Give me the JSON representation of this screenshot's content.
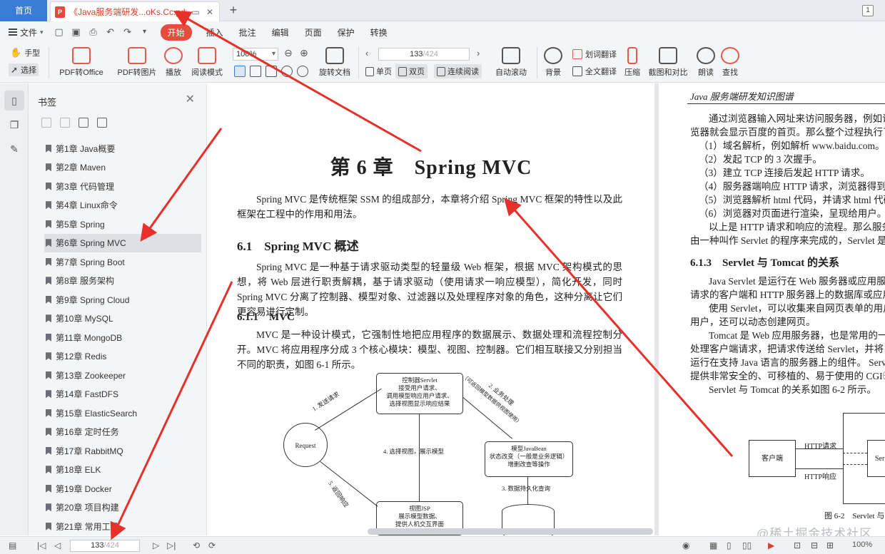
{
  "tabs": {
    "home": "首页",
    "doc_title": "《Java服务端研发...oKs.Cc.pdf",
    "count": "1"
  },
  "menu": {
    "file": "文件",
    "start": "开始",
    "items": [
      "插入",
      "批注",
      "编辑",
      "页面",
      "保护",
      "转换"
    ]
  },
  "ribbon": {
    "hand": "手型",
    "select": "选择",
    "pdf_to_office": "PDF转Office",
    "pdf_to_image": "PDF转图片",
    "play": "播放",
    "read_mode": "阅读模式",
    "zoom": "100%",
    "rotate": "旋转文档",
    "page_current": "133",
    "page_total": "/424",
    "single": "单页",
    "double": "双页",
    "continuous": "连续阅读",
    "auto_scroll": "自动滚动",
    "background": "背景",
    "word_translate": "划词翻译",
    "full_translate": "全文翻译",
    "compress": "压缩",
    "screenshot": "截图和对比",
    "read_aloud": "朗读",
    "find": "查找"
  },
  "sidebar": {
    "title": "书签",
    "items": [
      {
        "label": "第1章 Java概要"
      },
      {
        "label": "第2章 Maven"
      },
      {
        "label": "第3章 代码管理"
      },
      {
        "label": "第4章 Linux命令"
      },
      {
        "label": "第5章 Spring"
      },
      {
        "label": "第6章 Spring MVC"
      },
      {
        "label": "第7章 Spring Boot"
      },
      {
        "label": "第8章 服务架构"
      },
      {
        "label": "第9章 Spring Cloud"
      },
      {
        "label": "第10章 MySQL"
      },
      {
        "label": "第11章 MongoDB"
      },
      {
        "label": "第12章 Redis"
      },
      {
        "label": "第13章 Zookeeper"
      },
      {
        "label": "第14章 FastDFS"
      },
      {
        "label": "第15章 ElasticSearch"
      },
      {
        "label": "第16章 定时任务"
      },
      {
        "label": "第17章 RabbitMQ"
      },
      {
        "label": "第18章 ELK"
      },
      {
        "label": "第19章 Docker"
      },
      {
        "label": "第20章 项目构建"
      },
      {
        "label": "第21章 常用工具"
      }
    ]
  },
  "page1": {
    "chapter_title": "第 6 章　Spring MVC",
    "intro": "Spring MVC 是传统框架 SSM 的组成部分，本章将介绍 Spring MVC 框架的特性以及此框架在工程中的作用和用法。",
    "h_61": "6.1　Spring MVC 概述",
    "p_61": "Spring MVC 是一种基于请求驱动类型的轻量级 Web 框架，根据 MVC 架构模式的思想，将 Web 层进行职责解耦，基于请求驱动（使用请求一响应模型），简化开发，同时 Spring MVC 分离了控制器、模型对象、过滤器以及处理程序对象的角色，这种分离让它们更容易进行定制。",
    "h_611": "6.1.1　MVC",
    "p_611": "MVC 是一种设计模式，它强制性地把应用程序的数据展示、数据处理和流程控制分开。MVC 将应用程序分成 3 个核心模块：模型、视图、控制器。它们相互联接又分别担当不同的职责，如图 6-1 所示。",
    "diagram": {
      "controller": "控制器Servlet\n接受用户请求、\n调用模型响应用户请求、\n选择视图显示响应结果",
      "request": "Request",
      "model": "模型JavaBean\n状态改变（一般是业务逻辑）\n增删改查等操作",
      "view": "视图JSP\n展示模型数据、\n提供人机交互界面",
      "l1": "1. 发送请求",
      "l2": "2. 业务处理",
      "l2b": "（可返回模型数据供视图使用）",
      "l3": "3. 数据持久化查询",
      "l4": "4. 选择视图，展示模型",
      "l5": "5. 返回响应"
    }
  },
  "page2": {
    "header": "Java 服务端研发知识图谱",
    "lines": [
      "通过浏览器输入网址来访问服务器，例如访",
      "览器就会显示百度的首页。那么整个过程执行了怎",
      "（1）域名解析，例如解析 www.baidu.com。",
      "（2）发起 TCP 的 3 次握手。",
      "（3）建立 TCP 连接后发起 HTTP 请求。",
      "（4）服务器端响应 HTTP 请求，浏览器得到",
      "（5）浏览器解析 html 代码，并请求 html 代码",
      "（6）浏览器对页面进行渲染，呈现给用户。",
      "以上是 HTTP 请求和响应的流程。那么服务器",
      "由一种叫作 Servlet 的程序来完成的，Servlet 是为了"
    ],
    "h_613": "6.1.3　Servlet 与 Tomcat 的关系",
    "lines2": [
      "Java Servlet 是运行在 Web 服务器或应用服",
      "请求的客户端和 HTTP 服务器上的数据库或应用程",
      "使用 Servlet，可以收集来自网页表单的用户",
      "用户，还可以动态创建网页。",
      "Tomcat 是 Web 应用服务器，也是常用的一个",
      "处理客户端请求，把请求传送给 Servlet，并将 Se",
      "运行在支持 Java 语言的服务器上的组件。 Servle",
      "提供非常安全的、可移植的、易于使用的 CGI㊀替",
      "Servlet 与 Tomcat 的关系如图 6-2 所示。"
    ],
    "diagram": {
      "client": "客户端",
      "http_req": "HTTP请求",
      "http_resp": "HTTP响应",
      "server": "Ser"
    },
    "fig_caption": "图 6-2　Servlet 与"
  },
  "status": {
    "page_current": "133",
    "page_total": "/424",
    "zoom": "100%",
    "watermark": "@稀土掘金技术社区"
  },
  "colors": {
    "accent": "#3a7bd5",
    "start_btn": "#e54d3d",
    "arrow": "#e8302b"
  }
}
